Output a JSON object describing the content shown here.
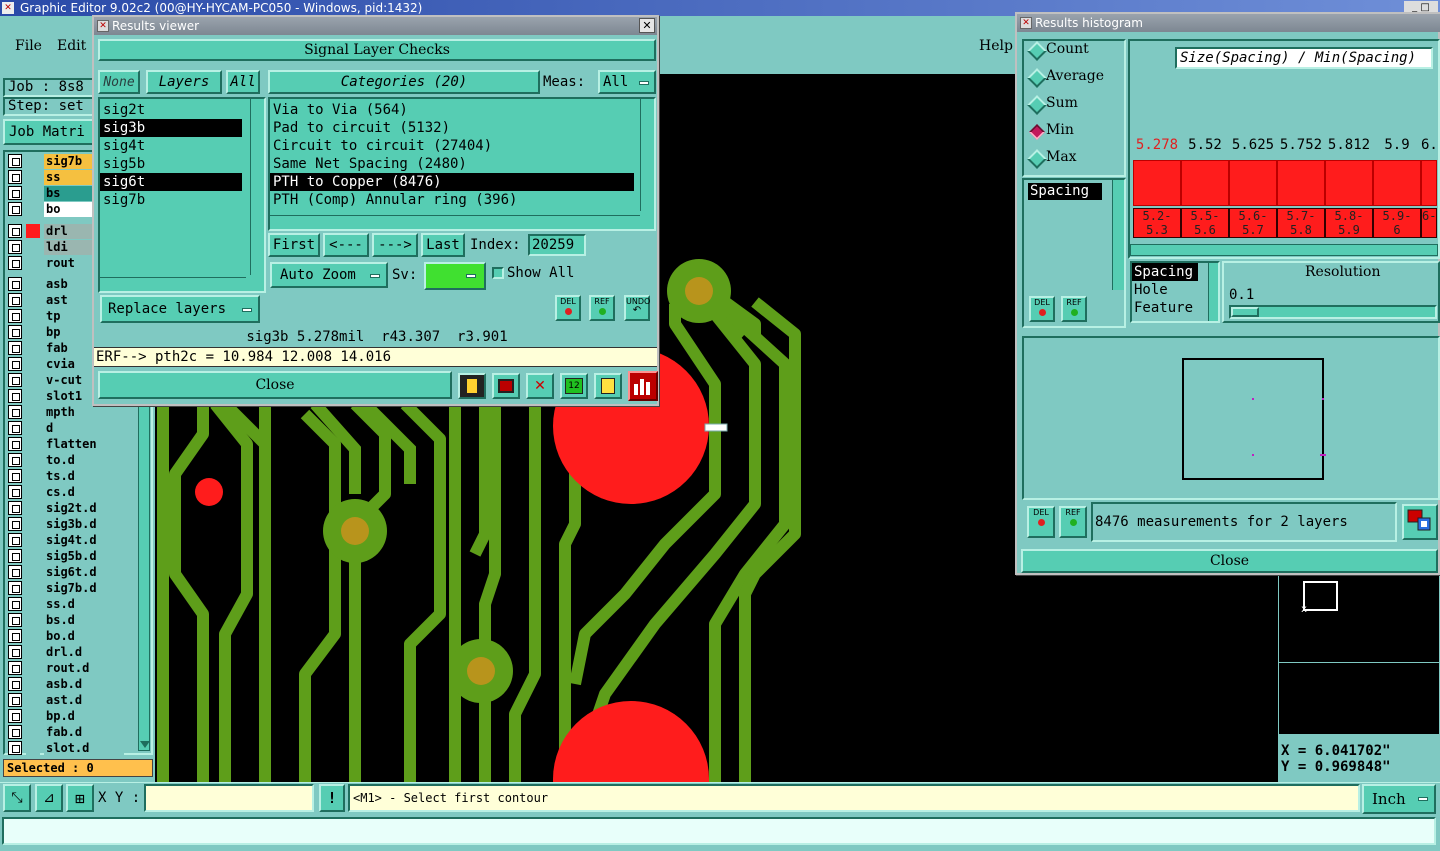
{
  "app": {
    "title": "Graphic Editor 9.02c2 (00@HY-HYCAM-PC050 - Windows, pid:1432)",
    "menu": [
      "File",
      "Edit"
    ],
    "help": "Help"
  },
  "job": {
    "job_label": "Job : 8s8",
    "step_label": "Step: set",
    "matrix_button": "Job Matri"
  },
  "layers": [
    {
      "name": "sig7b",
      "color": "#f5c040"
    },
    {
      "name": "ss",
      "color": "#f5c040"
    },
    {
      "name": "bs",
      "color": "#2a9d8f"
    },
    {
      "name": "bo",
      "color": "#ffffff"
    },
    {
      "name": "drl",
      "color": "#9ab6b0",
      "swatch": "#ff1c1c"
    },
    {
      "name": "ldi",
      "color": "#9ab6b0"
    },
    {
      "name": "rout",
      "color": "#7fc9c2"
    },
    {
      "name": "asb",
      "color": "#7fc9c2"
    },
    {
      "name": "ast",
      "color": "#7fc9c2"
    },
    {
      "name": "tp",
      "color": "#7fc9c2"
    },
    {
      "name": "bp",
      "color": "#7fc9c2"
    },
    {
      "name": "fab",
      "color": "#7fc9c2"
    },
    {
      "name": "cvia",
      "color": "#7fc9c2"
    },
    {
      "name": "v-cut",
      "color": "#7fc9c2"
    },
    {
      "name": "slot1",
      "color": "#7fc9c2"
    },
    {
      "name": "mpth",
      "color": "#7fc9c2"
    },
    {
      "name": "d",
      "color": "#7fc9c2"
    },
    {
      "name": "flatten",
      "color": "#7fc9c2"
    },
    {
      "name": "to.d",
      "color": "#7fc9c2"
    },
    {
      "name": "ts.d",
      "color": "#7fc9c2"
    },
    {
      "name": "cs.d",
      "color": "#7fc9c2"
    },
    {
      "name": "sig2t.d",
      "color": "#7fc9c2"
    },
    {
      "name": "sig3b.d",
      "color": "#7fc9c2"
    },
    {
      "name": "sig4t.d",
      "color": "#7fc9c2"
    },
    {
      "name": "sig5b.d",
      "color": "#7fc9c2"
    },
    {
      "name": "sig6t.d",
      "color": "#7fc9c2"
    },
    {
      "name": "sig7b.d",
      "color": "#7fc9c2"
    },
    {
      "name": "ss.d",
      "color": "#7fc9c2"
    },
    {
      "name": "bs.d",
      "color": "#7fc9c2"
    },
    {
      "name": "bo.d",
      "color": "#7fc9c2"
    },
    {
      "name": "drl.d",
      "color": "#7fc9c2"
    },
    {
      "name": "rout.d",
      "color": "#7fc9c2"
    },
    {
      "name": "asb.d",
      "color": "#7fc9c2"
    },
    {
      "name": "ast.d",
      "color": "#7fc9c2"
    },
    {
      "name": "bp.d",
      "color": "#7fc9c2"
    },
    {
      "name": "fab.d",
      "color": "#7fc9c2"
    },
    {
      "name": "slot.d",
      "color": "#7fc9c2"
    }
  ],
  "selected_label": "Selected : 0",
  "results_viewer": {
    "title": "Results viewer",
    "header": "Signal Layer Checks",
    "btn_none": "None",
    "btn_layers": "Layers",
    "btn_all": "All",
    "categories_label": "Categories (20)",
    "meas_label": "Meas:",
    "meas_value": "All",
    "layer_list": [
      {
        "name": "sig2t",
        "selected": false
      },
      {
        "name": "sig3b",
        "selected": true
      },
      {
        "name": "sig4t",
        "selected": false
      },
      {
        "name": "sig5b",
        "selected": false
      },
      {
        "name": "sig6t",
        "selected": true
      },
      {
        "name": "sig7b",
        "selected": false
      }
    ],
    "categories": [
      {
        "text": "Via to Via (564)",
        "selected": false
      },
      {
        "text": "Pad to circuit (5132)",
        "selected": false
      },
      {
        "text": "Circuit to circuit (27404)",
        "selected": false
      },
      {
        "text": "Same Net Spacing (2480)",
        "selected": false
      },
      {
        "text": "PTH to Copper (8476)",
        "selected": true
      },
      {
        "text": "PTH (Comp) Annular ring (396)",
        "selected": false
      }
    ],
    "btn_first": "First",
    "btn_prev": "<---",
    "btn_next": "--->",
    "btn_last": "Last",
    "index_label": "Index:",
    "index_value": "20259",
    "auto_zoom": "Auto Zoom",
    "sv_label": "Sv:",
    "show_all": "Show All",
    "replace_layers": "Replace layers",
    "del": "DEL",
    "ref": "REF",
    "undo": "UNDO",
    "status": "sig3b 5.278mil  r43.307  r3.901",
    "erf": "ERF--> pth2c = 10.984 12.008 14.016",
    "close": "Close"
  },
  "histogram": {
    "title": "Results histogram",
    "modes": [
      "Count",
      "Average",
      "Sum",
      "Min",
      "Max"
    ],
    "mode_selected": "Min",
    "metric_selected": "Spacing",
    "formula": "Size(Spacing) / Min(Spacing)",
    "bar_values": [
      "5.278",
      "5.52",
      "5.625",
      "5.752",
      "5.812",
      "5.9",
      "6."
    ],
    "bins": [
      "5.2-\n5.3",
      "5.5-\n5.6",
      "5.6-\n5.7",
      "5.7-\n5.8",
      "5.8-\n5.9",
      "5.9-\n6",
      "6-"
    ],
    "types": [
      "Spacing",
      "Hole",
      "Feature"
    ],
    "resolution_label": "Resolution",
    "resolution_value": "0.1",
    "measurements": "8476 measurements for 2 layers",
    "del": "DEL",
    "ref": "REF",
    "close": "Close"
  },
  "coords": {
    "x": "X = 6.041702\"",
    "y": "Y = 0.969848\""
  },
  "bottom": {
    "xy_label": "X Y :",
    "xy_value": "",
    "prompt": "<M1> - Select first contour",
    "units": "Inch",
    "excl": "!"
  }
}
